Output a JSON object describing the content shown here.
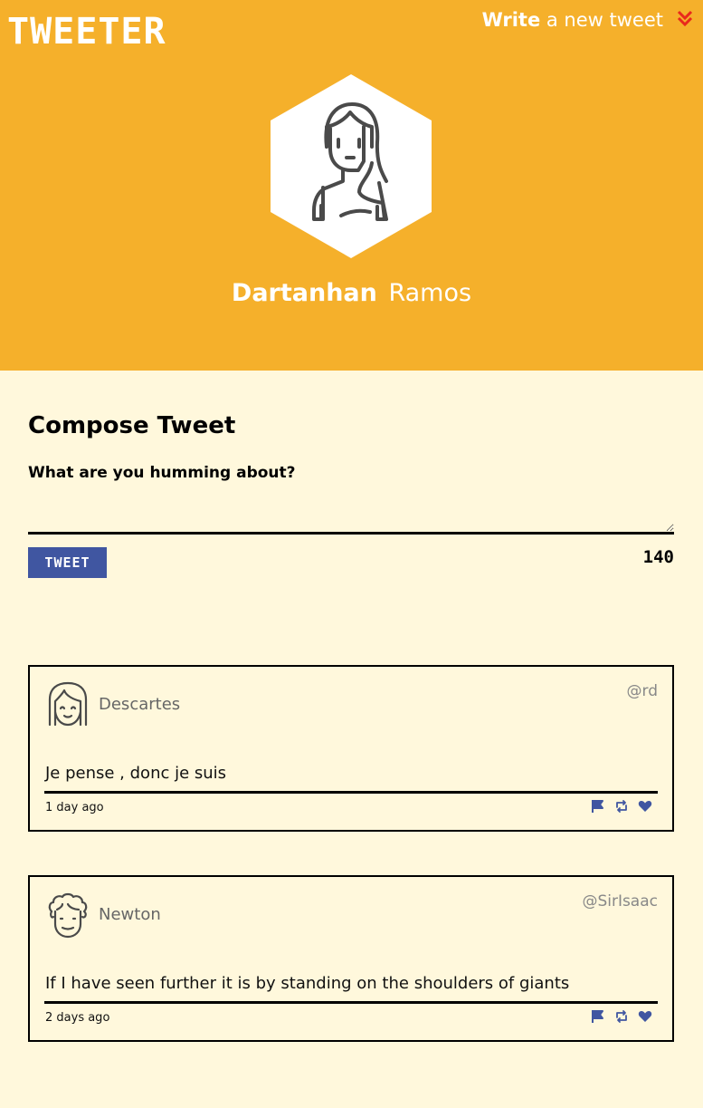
{
  "app": {
    "logo": "TWEETER",
    "nav_write_bold": "Write",
    "nav_write_rest": " a new tweet"
  },
  "profile": {
    "first_name": "Dartanhan",
    "last_name": "Ramos",
    "avatar_icon": "woman-avatar-icon"
  },
  "compose": {
    "title": "Compose Tweet",
    "prompt": "What are you humming about?",
    "textarea_value": "",
    "button_label": "TWEET",
    "counter": "140"
  },
  "tweets": [
    {
      "name": "Descartes",
      "handle": "@rd",
      "content": "Je pense , donc je suis",
      "time": "1 day ago",
      "avatar_icon": "girl-avatar-icon"
    },
    {
      "name": "Newton",
      "handle": "@SirIsaac",
      "content": "If I have seen further it is by standing on the shoulders of giants",
      "time": "2 days ago",
      "avatar_icon": "curly-man-avatar-icon"
    }
  ],
  "colors": {
    "header_bg": "#f5b02b",
    "page_bg": "#fff8dc",
    "accent_blue": "#4056a1",
    "chevron_red": "#e8291c"
  }
}
